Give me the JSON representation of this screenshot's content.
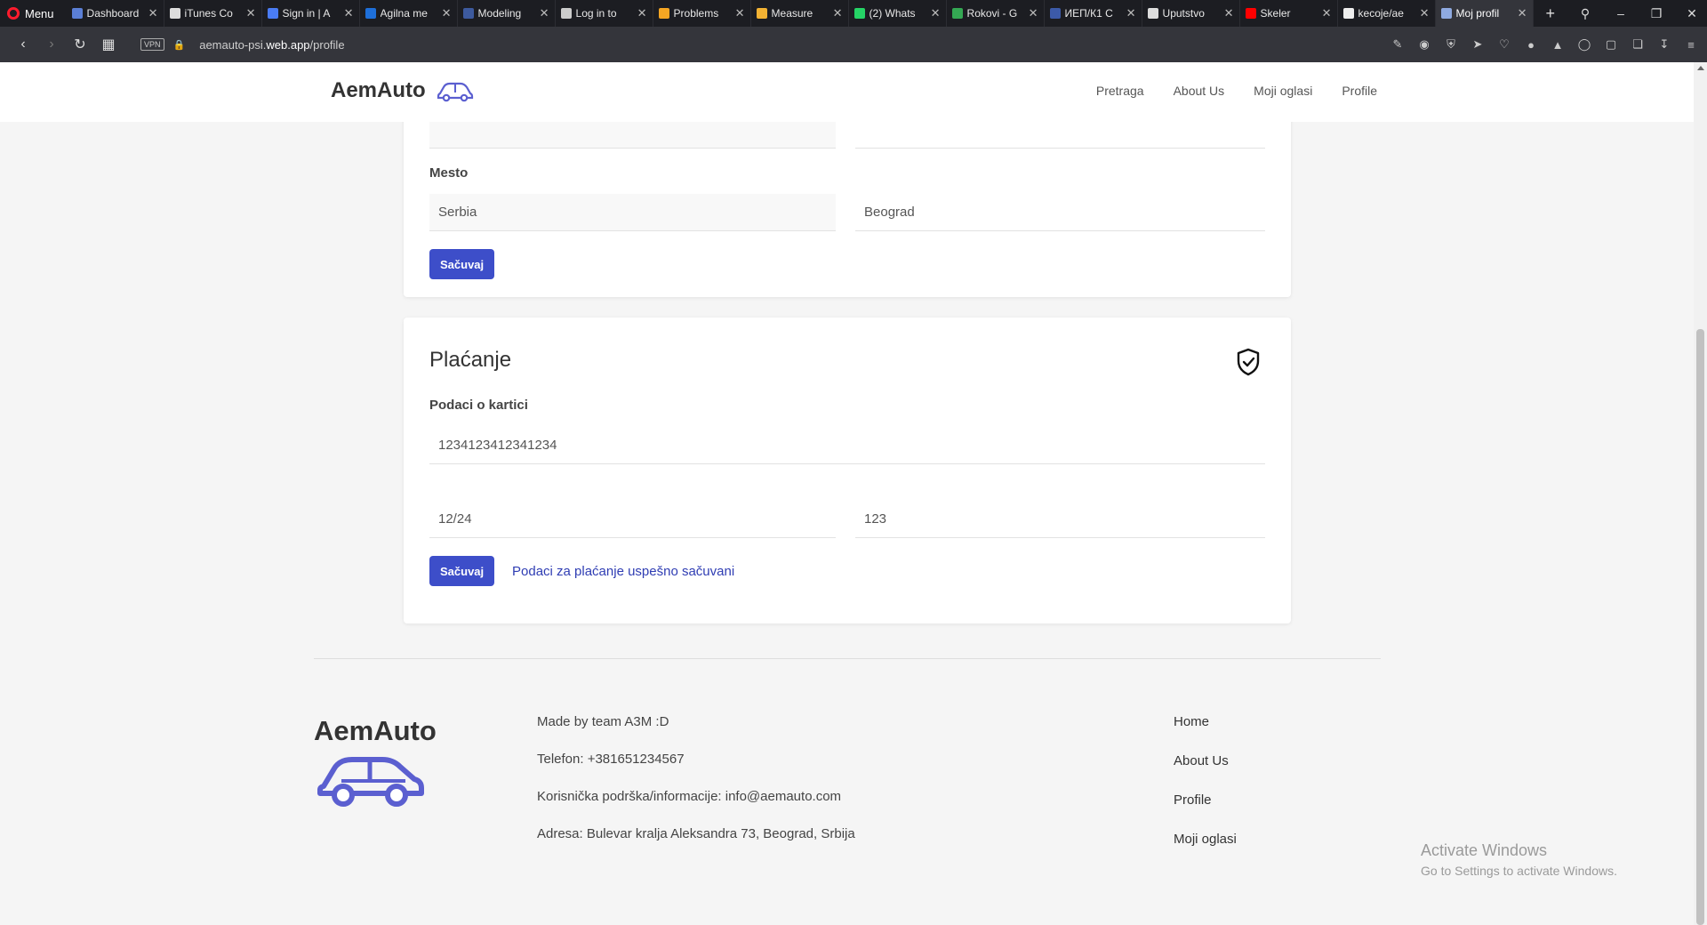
{
  "browser": {
    "menu_label": "Menu",
    "tabs": [
      {
        "title": "Dashboard",
        "color": "#5b7fd6"
      },
      {
        "title": "iTunes Co",
        "color": "#dddddd"
      },
      {
        "title": "Sign in | A",
        "color": "#4a7cf3"
      },
      {
        "title": "Agilna me",
        "color": "#1e6fd9"
      },
      {
        "title": "Modeling",
        "color": "#3d5a9e"
      },
      {
        "title": "Log in to",
        "color": "#cccccc"
      },
      {
        "title": "Problems",
        "color": "#f5a623"
      },
      {
        "title": "Measure",
        "color": "#f2b233"
      },
      {
        "title": "(2) Whats",
        "color": "#25d366"
      },
      {
        "title": "Rokovi - G",
        "color": "#34a853"
      },
      {
        "title": "ИЕП/К1 С",
        "color": "#3c5aa8"
      },
      {
        "title": "Uputstvo",
        "color": "#dddddd"
      },
      {
        "title": "Skeler",
        "color": "#ff0000"
      },
      {
        "title": "kecoje/ae",
        "color": "#eeeeee"
      },
      {
        "title": "Moj profil",
        "color": "#8faae0",
        "active": true
      }
    ],
    "new_tab_label": "+",
    "url_prefix": "aemauto-psi.",
    "url_domain": "web.app",
    "url_path": "/profile",
    "vpn_label": "VPN"
  },
  "header": {
    "brand": "AemAuto",
    "nav": [
      "Pretraga",
      "About Us",
      "Moji oglasi",
      "Profile"
    ]
  },
  "address_card": {
    "place_label": "Mesto",
    "country_value": "Serbia",
    "city_value": "Beograd",
    "save_label": "Sačuvaj"
  },
  "payment_card": {
    "title": "Plaćanje",
    "card_label": "Podaci o kartici",
    "card_number": "1234123412341234",
    "expiry": "12/24",
    "cvv": "123",
    "save_label": "Sačuvaj",
    "success_message": "Podaci za plaćanje uspešno sačuvani"
  },
  "footer": {
    "brand": "AemAuto",
    "info": [
      "Made by team A3M :D",
      "Telefon: +381651234567",
      "Korisnička podrška/informacije: info@aemauto.com",
      "Adresa: Bulevar kralja Aleksandra 73, Beograd, Srbija"
    ],
    "links": [
      "Home",
      "About Us",
      "Profile",
      "Moji oglasi"
    ]
  },
  "watermark": {
    "line1": "Activate Windows",
    "line2": "Go to Settings to activate Windows."
  },
  "colors": {
    "accent": "#3d4ec9",
    "car_icon": "#5b5fd0"
  }
}
